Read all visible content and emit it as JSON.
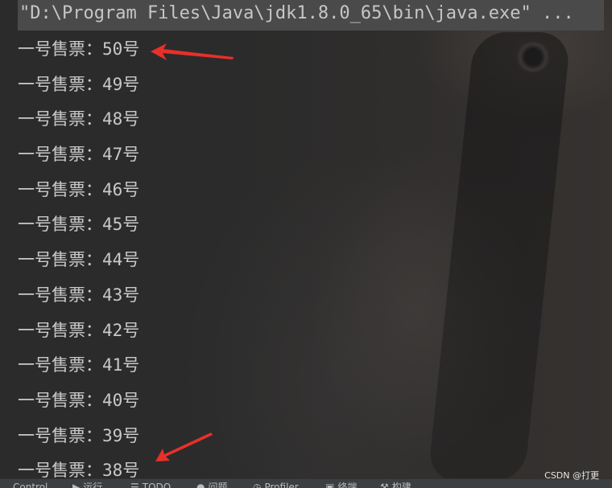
{
  "console": {
    "command": "\"D:\\Program Files\\Java\\jdk1.8.0_65\\bin\\java.exe\" ...",
    "lines": [
      "一号售票：50号",
      "一号售票：49号",
      "一号售票：48号",
      "一号售票：47号",
      "一号售票：46号",
      "一号售票：45号",
      "一号售票：44号",
      "一号售票：43号",
      "一号售票：42号",
      "一号售票：41号",
      "一号售票：40号",
      "一号售票：39号",
      "一号售票：38号"
    ]
  },
  "statusbar": {
    "items": [
      {
        "label": "Control",
        "icon": "terminal-icon"
      },
      {
        "label": "运行",
        "icon": "run-icon"
      },
      {
        "label": "TODO",
        "icon": "todo-icon"
      },
      {
        "label": "问题",
        "icon": "problems-icon"
      },
      {
        "label": "Profiler",
        "icon": "profiler-icon"
      },
      {
        "label": "终端",
        "icon": "terminal-icon"
      },
      {
        "label": "构建",
        "icon": "build-icon"
      }
    ]
  },
  "watermark": "CSDN @打更",
  "colors": {
    "arrow": "#e8302a",
    "text": "#c9c9c9",
    "command_bg": "#4a4a4a"
  }
}
